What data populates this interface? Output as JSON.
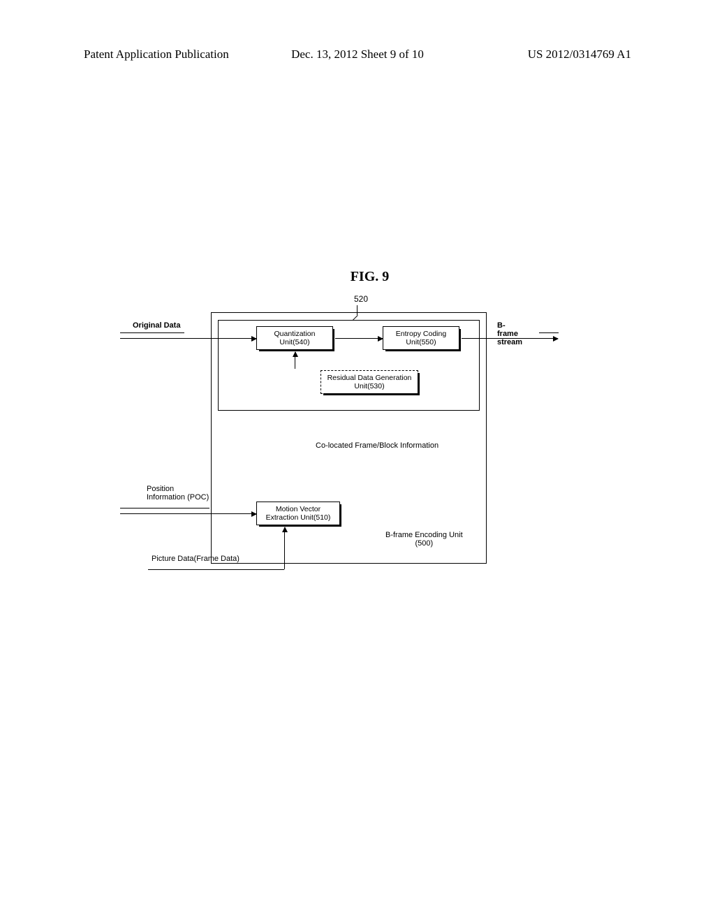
{
  "header": {
    "left": "Patent Application Publication",
    "middle": "Dec. 13, 2012  Sheet 9 of 10",
    "right": "US 2012/0314769 A1"
  },
  "figure": {
    "title": "FIG. 9",
    "ref_number": "520",
    "labels": {
      "original_data": "Original Data",
      "bframe_stream": "B-frame stream",
      "colocated": "Co-located Frame/Block Information",
      "position_info": "Position\nInformation (POC)",
      "bframe_unit": "B-frame Encoding Unit\n(500)",
      "picture_data": "Picture Data(Frame Data)"
    },
    "blocks": {
      "quantization": "Quantization\nUnit(540)",
      "entropy": "Entropy Coding\nUnit(550)",
      "residual": "Residual Data\nGeneration Unit(530)",
      "motion_vector": "Motion Vector\nExtraction Unit(510)"
    }
  }
}
